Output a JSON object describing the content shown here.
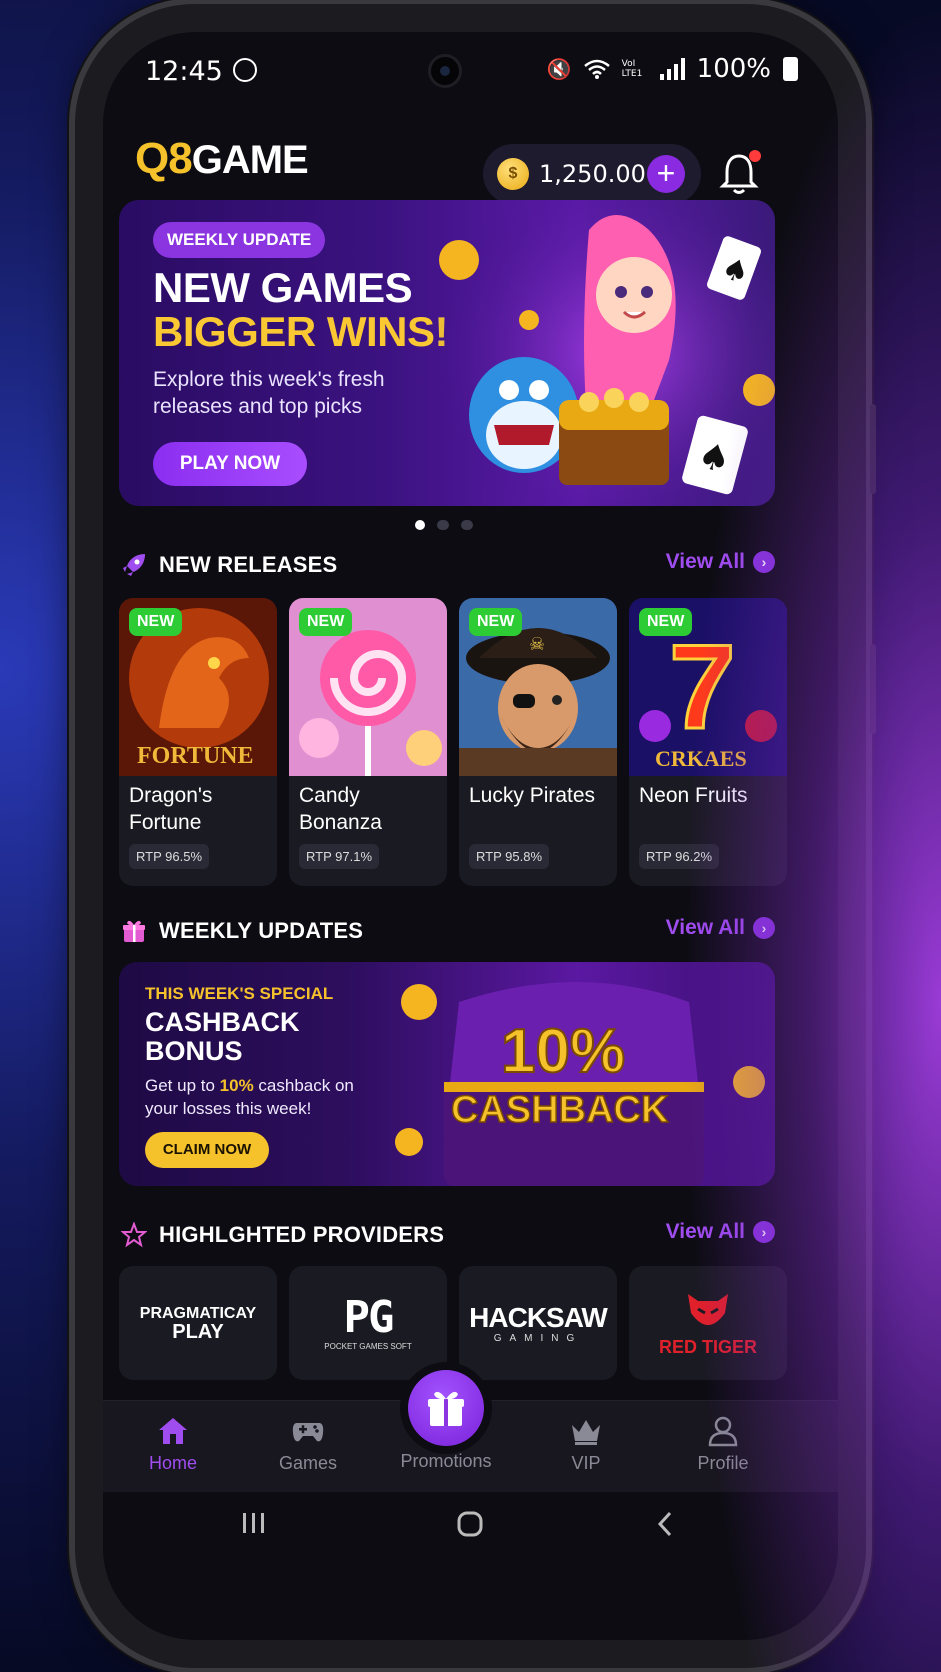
{
  "status": {
    "time": "12:45",
    "battery": "100%",
    "network": "VoI LTE1"
  },
  "header": {
    "logo_q8": "Q8",
    "logo_game": "GAME",
    "balance": "1,250.00",
    "coin_glyph": "$"
  },
  "hero": {
    "badge": "WEEKLY UPDATE",
    "title1": "NEW GAMES",
    "title2": "BIGGER WINS!",
    "subtitle": "Explore this week's fresh releases and top picks",
    "cta": "PLAY NOW"
  },
  "new_releases": {
    "title": "NEW RELEASES",
    "view_all": "View All",
    "games": [
      {
        "badge": "NEW",
        "name": "Dragon's Fortune",
        "rtp": "RTP 96.5%",
        "art_text": "FORTUNE"
      },
      {
        "badge": "NEW",
        "name": "Candy Bonanza",
        "rtp": "RTP 97.1%",
        "art_text": ""
      },
      {
        "badge": "NEW",
        "name": "Lucky Pirates",
        "rtp": "RTP 95.8%",
        "art_text": ""
      },
      {
        "badge": "NEW",
        "name": "Neon Fruits",
        "rtp": "RTP 96.2%",
        "art_text": "CRKAES"
      }
    ]
  },
  "weekly_updates": {
    "title": "WEEKLY UPDATES",
    "view_all": "View All",
    "kicker": "THIS WEEK'S SPECIAL",
    "headline": "CASHBACK BONUS",
    "desc_pre": "Get up to ",
    "desc_highlight": "10%",
    "desc_post": " cashback on your losses this week!",
    "cta": "CLAIM NOW",
    "art_big": "10%",
    "art_word": "CASHBACK"
  },
  "providers": {
    "title": "HIGHLGHTED PROVIDERS",
    "view_all": "View All",
    "items": [
      {
        "line1": "PRAGMATICAY",
        "line2": "PLAY"
      },
      {
        "line1": "PG",
        "line2": "POCKET GAMES SOFT"
      },
      {
        "line1": "HACKSAW",
        "line2": "GAMING"
      },
      {
        "line1": "RED TIGER",
        "line2": ""
      }
    ]
  },
  "nav": {
    "home": "Home",
    "games": "Games",
    "promotions": "Promotions",
    "vip": "VIP",
    "profile": "Profile"
  },
  "colors": {
    "accent": "#a04df0",
    "gold": "#f6c22b",
    "new_badge": "#2ecc34"
  }
}
